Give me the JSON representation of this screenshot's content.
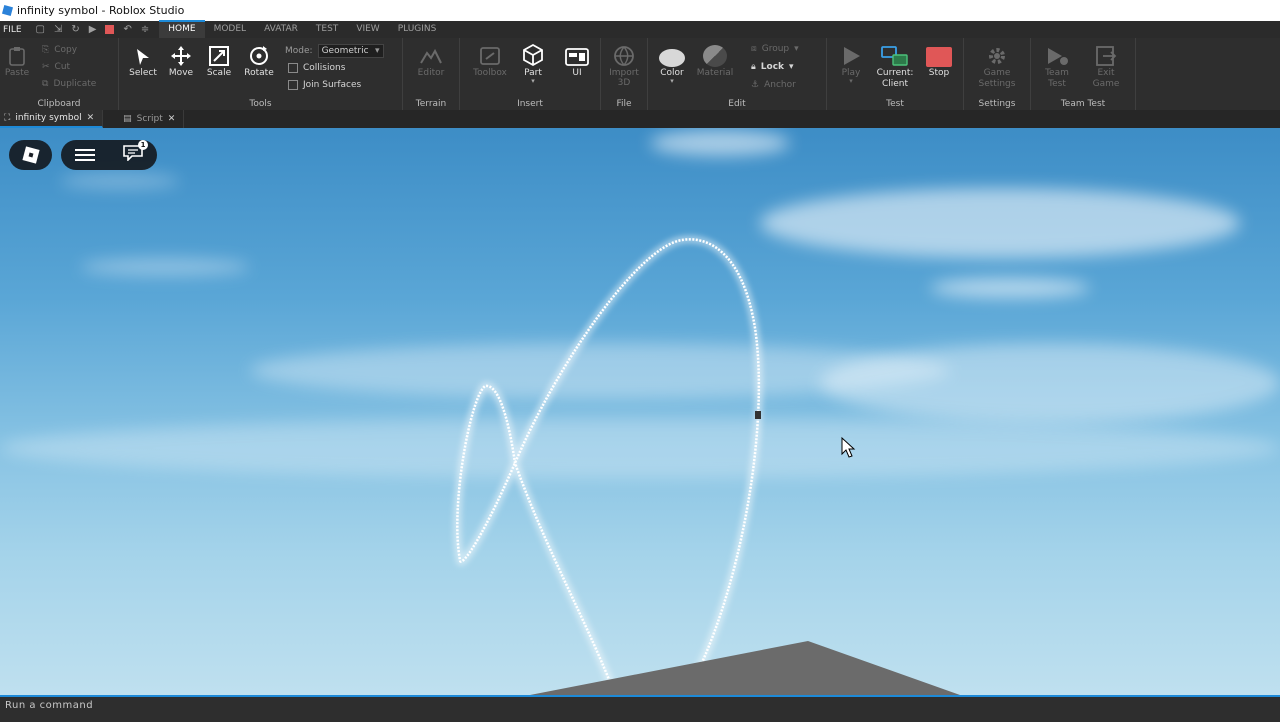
{
  "window": {
    "title": "infinity symbol - Roblox Studio"
  },
  "menu": {
    "file": "FILE",
    "tabs": [
      "HOME",
      "MODEL",
      "AVATAR",
      "TEST",
      "VIEW",
      "PLUGINS"
    ]
  },
  "ribbon": {
    "clipboard": {
      "label": "Clipboard",
      "paste": "Paste",
      "copy": "Copy",
      "cut": "Cut",
      "duplicate": "Duplicate"
    },
    "tools": {
      "label": "Tools",
      "select": "Select",
      "move": "Move",
      "scale": "Scale",
      "rotate": "Rotate",
      "mode_label": "Mode:",
      "mode_value": "Geometric",
      "collisions": "Collisions",
      "join_surfaces": "Join Surfaces"
    },
    "terrain": {
      "label": "Terrain",
      "editor": "Editor"
    },
    "insert": {
      "label": "Insert",
      "toolbox": "Toolbox",
      "part": "Part",
      "ui": "UI"
    },
    "file": {
      "label": "File",
      "import_3d": "Import 3D"
    },
    "edit": {
      "label": "Edit",
      "color": "Color",
      "material": "Material",
      "group": "Group",
      "lock": "Lock",
      "anchor": "Anchor"
    },
    "test": {
      "label": "Test",
      "play": "Play",
      "current_client": "Current: Client",
      "stop": "Stop"
    },
    "settings": {
      "label": "Settings",
      "game_settings": "Game Settings"
    },
    "team_test": {
      "label": "Team Test",
      "team_test": "Team Test",
      "exit_game": "Exit Game"
    }
  },
  "doc_tabs": [
    {
      "label": "infinity symbol",
      "active": true
    },
    {
      "label": "Script",
      "active": false
    }
  ],
  "viewport": {
    "chat_badge": "1"
  },
  "command_bar": {
    "placeholder": "Run a command"
  },
  "colors": {
    "accent": "#1d8ad8",
    "stop": "#e05757",
    "sky_top": "#3d8dc6",
    "sky_bottom": "#bfe0ef"
  }
}
